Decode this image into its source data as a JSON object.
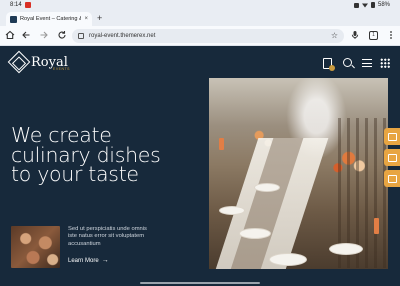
{
  "status_bar": {
    "time": "8:14",
    "battery": "58%"
  },
  "tabs": [
    {
      "title": "Royal Event – Catering & W",
      "close": "×"
    }
  ],
  "new_tab": "+",
  "toolbar": {
    "url": "royal-event.themerex.net",
    "tab_count": "1"
  },
  "site": {
    "logo_name": "Royal",
    "logo_sub": "EVENTS",
    "hero_lines": [
      "We create",
      "culinary dishes",
      "to your taste"
    ],
    "description": "Sed ut perspiciatis unde omnis iste natus error sit voluptatem accusantium",
    "learn_more": "Learn More",
    "learn_more_arrow": "→"
  },
  "colors": {
    "page_bg": "#17293b",
    "accent": "#c99a3e",
    "side_tab": "#e8a542"
  },
  "icons": {
    "home": "home-icon",
    "back": "back-arrow-icon",
    "forward": "forward-arrow-icon",
    "reload": "reload-icon",
    "site_settings": "tune-icon",
    "star": "bookmark-star-icon",
    "mic": "mic-icon",
    "menu": "more-vertical-icon",
    "cart": "cart-icon",
    "search": "search-icon",
    "hamburger": "hamburger-menu-icon",
    "grid": "grid-dots-icon"
  }
}
